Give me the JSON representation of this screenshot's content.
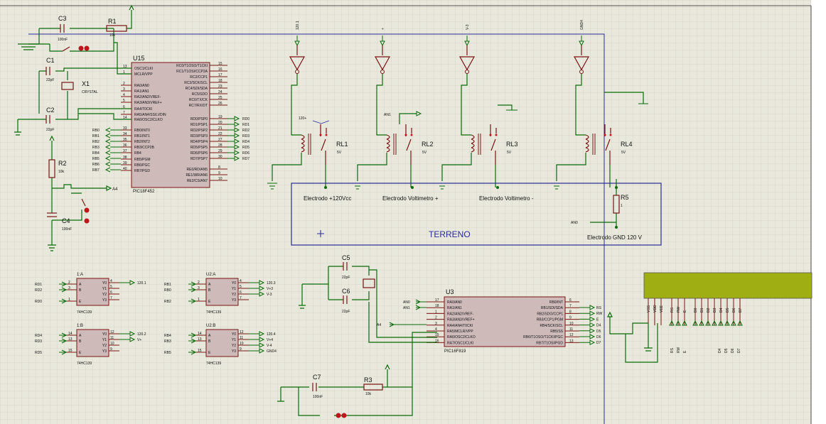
{
  "colors": {
    "background": "#e9e8dc",
    "grid": "#c9c8b8",
    "wire": "#0a6b0a",
    "component": "#7a1414",
    "chip_fill": "#cfbaba",
    "sheet_border": "#2a2a9a",
    "lcd_fill": "#9fae12"
  },
  "u15": {
    "ref": "U15",
    "part": "PIC18F452",
    "left_pins": [
      {
        "num": "13",
        "name": "OSC1/CLKI"
      },
      {
        "num": "1",
        "name": "MCLR/VPP"
      },
      {
        "num": "2",
        "name": "RA0/AN0"
      },
      {
        "num": "3",
        "name": "RA1/AN1"
      },
      {
        "num": "4",
        "name": "RA2/AN2/VREF-"
      },
      {
        "num": "5",
        "name": "RA3/AN3/VREF+"
      },
      {
        "num": "6",
        "name": "RA4/T0CKI"
      },
      {
        "num": "7",
        "name": "RA5/AN4/SS/LVDIN"
      },
      {
        "num": "14",
        "name": "RA6/OSC2/CLKO"
      },
      {
        "num": "33",
        "name": "RB0/INT0"
      },
      {
        "num": "34",
        "name": "RB1/INT1"
      },
      {
        "num": "35",
        "name": "RB2/INT2"
      },
      {
        "num": "36",
        "name": "RB3/CCP2B"
      },
      {
        "num": "37",
        "name": "RB4"
      },
      {
        "num": "38",
        "name": "RB5/PGM"
      },
      {
        "num": "39",
        "name": "RB6/PGC"
      },
      {
        "num": "40",
        "name": "RB7/PGD"
      }
    ],
    "right_pins": [
      {
        "num": "15",
        "name": "RC0/T1OSO/T1CKI"
      },
      {
        "num": "16",
        "name": "RC1/T1OSI/CCP2A"
      },
      {
        "num": "17",
        "name": "RC2/CCP1"
      },
      {
        "num": "18",
        "name": "RC3/SCK/SCL"
      },
      {
        "num": "23",
        "name": "RC4/SDI/SDA"
      },
      {
        "num": "24",
        "name": "RC5/SDO"
      },
      {
        "num": "25",
        "name": "RC6/TX/CK"
      },
      {
        "num": "26",
        "name": "RC7/RX/DT"
      },
      {
        "num": "19",
        "name": "RD0/PSP0"
      },
      {
        "num": "20",
        "name": "RD1/PSP1"
      },
      {
        "num": "21",
        "name": "RD2/PSP2"
      },
      {
        "num": "22",
        "name": "RD3/PSP3"
      },
      {
        "num": "27",
        "name": "RD4/PSP4"
      },
      {
        "num": "28",
        "name": "RD5/PSP5"
      },
      {
        "num": "29",
        "name": "RD6/PSP6"
      },
      {
        "num": "30",
        "name": "RD7/PSP7"
      },
      {
        "num": "8",
        "name": "RE0/RD/AN5"
      },
      {
        "num": "9",
        "name": "RE1/WR/AN6"
      },
      {
        "num": "10",
        "name": "RE2/CS/AN7"
      }
    ],
    "rd_nets": [
      "RD0",
      "RD1",
      "RD2",
      "RD3",
      "RD4",
      "RD5",
      "RD6",
      "RD7"
    ],
    "rb_nets": [
      "RB0",
      "RB1",
      "RB2",
      "RB3",
      "RB4",
      "RB5",
      "RB6",
      "RB7"
    ]
  },
  "components": {
    "c3": {
      "ref": "C3",
      "value": "100nF"
    },
    "r1": {
      "ref": "R1",
      "value": "10k"
    },
    "c1": {
      "ref": "C1",
      "value": "22pF"
    },
    "x1": {
      "ref": "X1",
      "value": "CRYSTAL"
    },
    "c2": {
      "ref": "C2",
      "value": "22pF"
    },
    "r2": {
      "ref": "R2",
      "value": "10k"
    },
    "c4": {
      "ref": "C4",
      "value": "100nF"
    },
    "a4_net": "A4",
    "c5": {
      "ref": "C5",
      "value": "22pF"
    },
    "c6": {
      "ref": "C6",
      "value": "22pF"
    },
    "c7": {
      "ref": "C7",
      "value": "100nF"
    },
    "r3": {
      "ref": "R3",
      "value": "10k"
    },
    "r5": {
      "ref": "R5",
      "value": "1"
    }
  },
  "decoders": [
    {
      "ref": "1:A",
      "part": "74HC139",
      "inputs": [
        {
          "net": "RD1",
          "pin": "2",
          "name": "A"
        },
        {
          "net": "RD2",
          "pin": "3",
          "name": "B"
        },
        {
          "net": "RD0",
          "pin": "1",
          "name": "E"
        }
      ],
      "outputs": [
        {
          "name": "Y0",
          "pin": "4",
          "net": "120.1"
        },
        {
          "name": "Y1",
          "pin": "5",
          "net": ""
        },
        {
          "name": "Y2",
          "pin": "6",
          "net": ""
        },
        {
          "name": "Y3",
          "pin": "7",
          "net": ""
        }
      ]
    },
    {
      "ref": "U2:A",
      "part": "74HC139",
      "inputs": [
        {
          "net": "RB1",
          "pin": "2",
          "name": "A"
        },
        {
          "net": "RB0",
          "pin": "3",
          "name": "B"
        },
        {
          "net": "RB2",
          "pin": "1",
          "name": "E"
        }
      ],
      "outputs": [
        {
          "name": "Y0",
          "pin": "4",
          "net": "120.3"
        },
        {
          "name": "Y1",
          "pin": "5",
          "net": "V+3"
        },
        {
          "name": "Y2",
          "pin": "6",
          "net": "V-3"
        },
        {
          "name": "Y3",
          "pin": "7",
          "net": ""
        }
      ]
    },
    {
      "ref": "1:B",
      "part": "74HC139",
      "inputs": [
        {
          "net": "RD4",
          "pin": "14",
          "name": "A"
        },
        {
          "net": "RD3",
          "pin": "13",
          "name": "B"
        },
        {
          "net": "RD5",
          "pin": "15",
          "name": "E"
        }
      ],
      "outputs": [
        {
          "name": "Y0",
          "pin": "12",
          "net": "120.2"
        },
        {
          "name": "Y1",
          "pin": "11",
          "net": "V+"
        },
        {
          "name": "Y2",
          "pin": "10",
          "net": ""
        },
        {
          "name": "Y3",
          "pin": "9",
          "net": ""
        }
      ]
    },
    {
      "ref": "U2:B",
      "part": "74HC139",
      "inputs": [
        {
          "net": "RB4",
          "pin": "14",
          "name": "A"
        },
        {
          "net": "RB3",
          "pin": "13",
          "name": "B"
        },
        {
          "net": "RB5",
          "pin": "15",
          "name": "E"
        }
      ],
      "outputs": [
        {
          "name": "Y0",
          "pin": "12",
          "net": "120.4"
        },
        {
          "name": "Y1",
          "pin": "11",
          "net": "V+4"
        },
        {
          "name": "Y2",
          "pin": "10",
          "net": "V-4"
        },
        {
          "name": "Y3",
          "pin": "9",
          "net": "GND4"
        }
      ]
    }
  ],
  "relays": [
    {
      "ref": "RL1",
      "value": "5V",
      "input_net": "120.1",
      "probe": "120+"
    },
    {
      "ref": "RL2",
      "value": "5V",
      "input_net": "+",
      "probe": "AN1"
    },
    {
      "ref": "RL3",
      "value": "5V",
      "input_net": "V-3",
      "probe": ""
    },
    {
      "ref": "RL4",
      "value": "5V",
      "input_net": "GND4",
      "probe": ""
    }
  ],
  "terreno": {
    "title": "TERRENO",
    "electrodes": [
      "Electrodo +120Vcc",
      "Electrodo Voltimetro +",
      "Electrodo Voltimetro -",
      "Electrodo GND 120 V"
    ],
    "an0_net": "AN0"
  },
  "u3": {
    "ref": "U3",
    "part": "PIC16F819",
    "left_pins": [
      {
        "num": "17",
        "name": "RA0/AN0"
      },
      {
        "num": "18",
        "name": "RA1/AN1"
      },
      {
        "num": "1",
        "name": "RA2/AN2/VREF-"
      },
      {
        "num": "2",
        "name": "RA3/AN3/VREF+"
      },
      {
        "num": "3",
        "name": "RA4/AN4/T0CKI"
      },
      {
        "num": "4",
        "name": "RA5/MCLR/VPP"
      },
      {
        "num": "15",
        "name": "RA6/OSC2/CLKO"
      },
      {
        "num": "16",
        "name": "RA7/OSC1/CLKI"
      }
    ],
    "right_pins": [
      {
        "num": "6",
        "name": "RB0/INT"
      },
      {
        "num": "7",
        "name": "RB1/SDI/SDA"
      },
      {
        "num": "8",
        "name": "RB2/SDO/CCP1"
      },
      {
        "num": "9",
        "name": "RB3/CCP1/PGM"
      },
      {
        "num": "10",
        "name": "RB4/SCK/SCL"
      },
      {
        "num": "11",
        "name": "RB5/SS"
      },
      {
        "num": "12",
        "name": "RB6/T1OSO/T1CKI/PGC"
      },
      {
        "num": "13",
        "name": "RB7/T1OSI/PGD"
      }
    ],
    "in_nets": [
      "AN0",
      "AN1",
      "A4"
    ],
    "out_nets": [
      "RS",
      "RW",
      "E",
      "D4",
      "D5",
      "D6",
      "D7"
    ]
  },
  "lcd": {
    "pins": [
      "VSS",
      "VDD",
      "VEE",
      "RS",
      "RW",
      "E",
      "D0",
      "D1",
      "D2",
      "D3",
      "D4",
      "D5",
      "D6",
      "D7"
    ],
    "bottom_labels": [
      "RS",
      "RW",
      "E",
      "D4",
      "D5",
      "D6",
      "D7"
    ]
  }
}
